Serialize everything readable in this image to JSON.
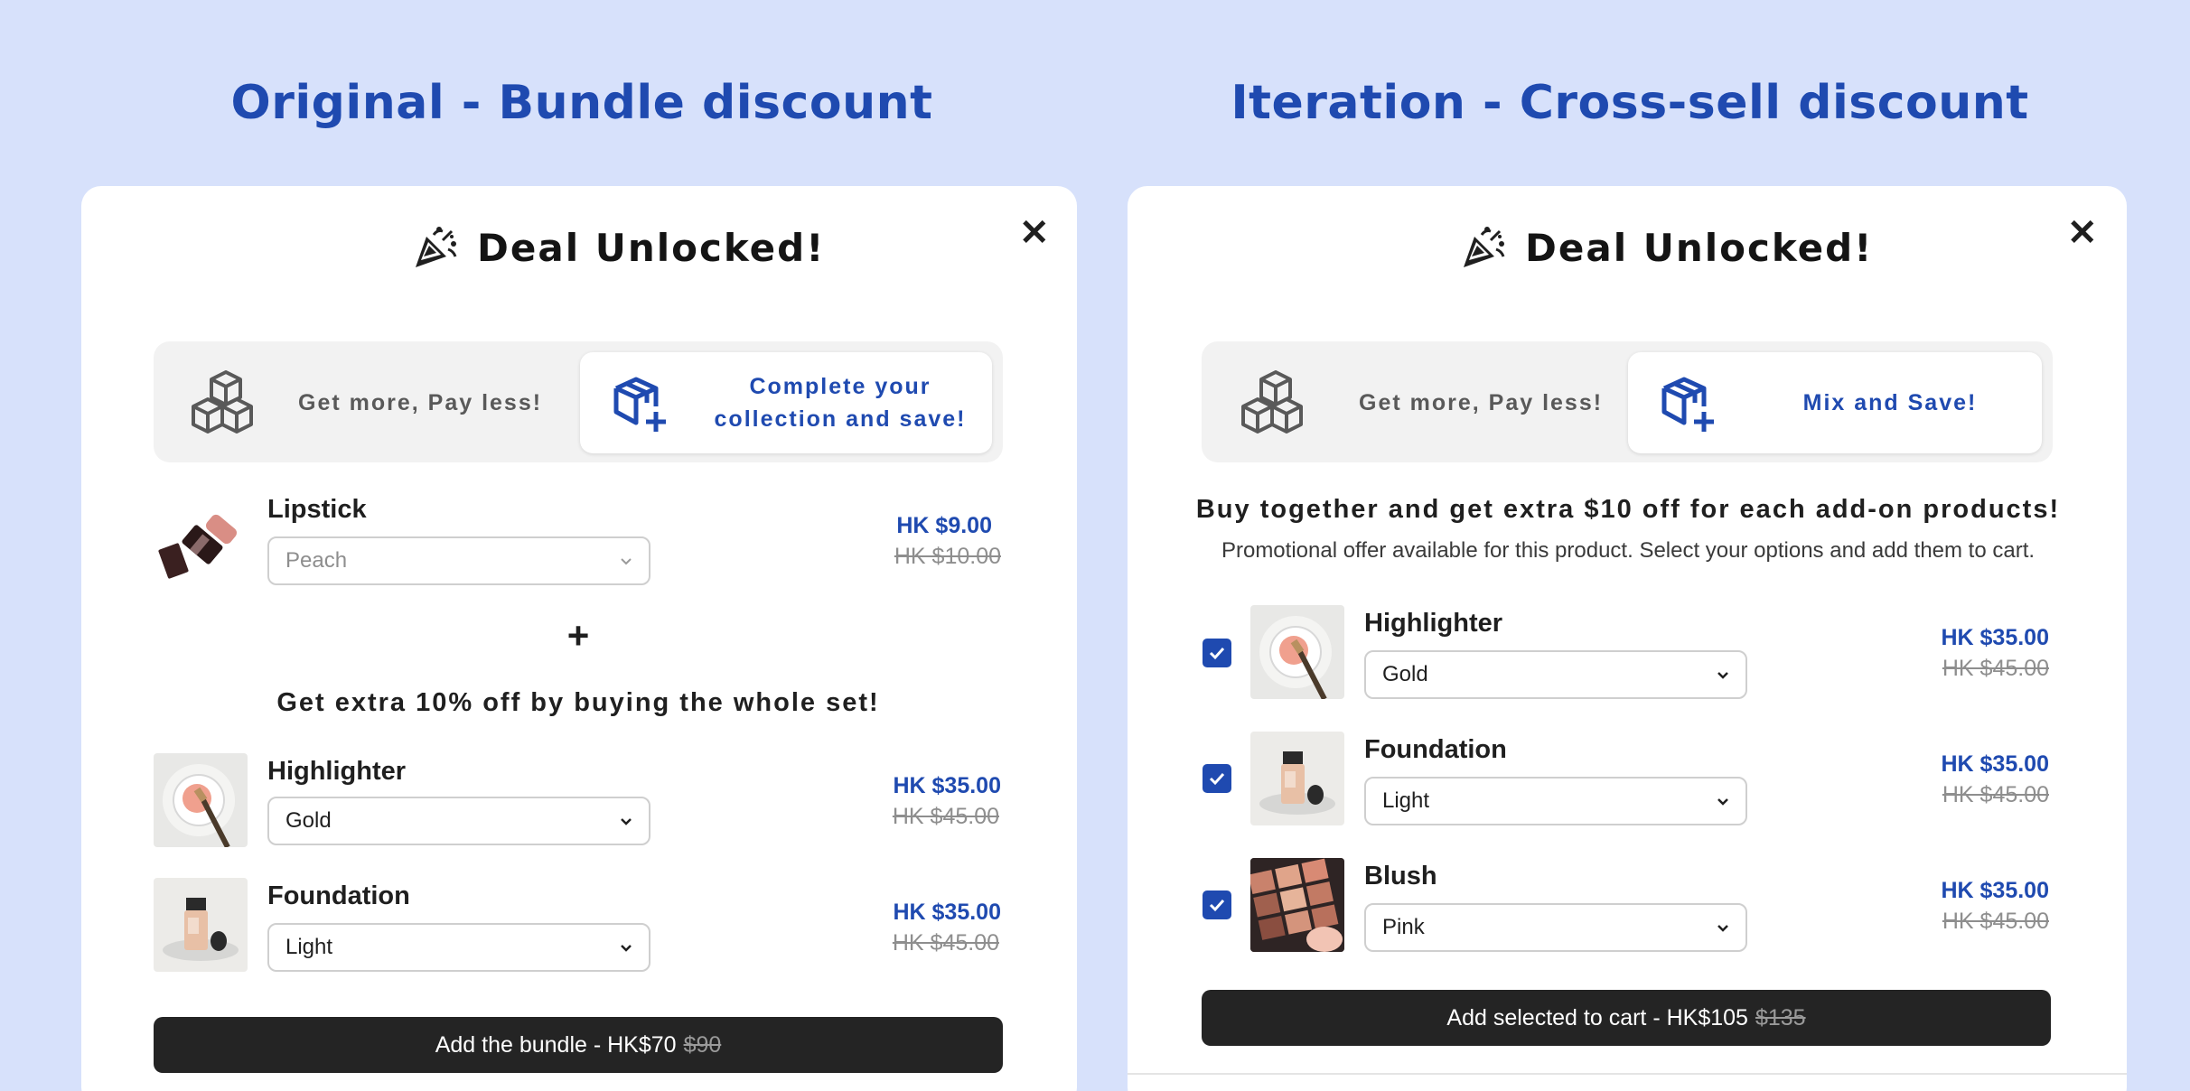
{
  "left": {
    "heading": "Original - Bundle discount",
    "title": "Deal Unlocked!",
    "tabs": [
      {
        "label": "Get more, Pay less!"
      },
      {
        "label_line1": "Complete your",
        "label_line2": "collection and save!"
      }
    ],
    "main_product": {
      "name": "Lipstick",
      "option": "Peach",
      "price": "HK $9.00",
      "old_price": "HK $10.00"
    },
    "plus": "+",
    "promo": "Get extra 10% off by buying the whole set!",
    "products": [
      {
        "name": "Highlighter",
        "option": "Gold",
        "price": "HK $35.00",
        "old_price": "HK $45.00"
      },
      {
        "name": "Foundation",
        "option": "Light",
        "price": "HK $35.00",
        "old_price": "HK $45.00"
      }
    ],
    "cta": {
      "label": "Add the bundle - HK$70",
      "old": "$90"
    }
  },
  "right": {
    "heading": "Iteration - Cross-sell discount",
    "title": "Deal Unlocked!",
    "tabs": [
      {
        "label": "Get more, Pay less!"
      },
      {
        "label": "Mix and Save!"
      }
    ],
    "promo_title": "Buy together and get extra $10 off for each add-on products!",
    "promo_sub": "Promotional offer available for this product. Select your options and add them to cart.",
    "products": [
      {
        "name": "Highlighter",
        "option": "Gold",
        "price": "HK $35.00",
        "old_price": "HK $45.00",
        "checked": true
      },
      {
        "name": "Foundation",
        "option": "Light",
        "price": "HK $35.00",
        "old_price": "HK $45.00",
        "checked": true
      },
      {
        "name": "Blush",
        "option": "Pink",
        "price": "HK $35.00",
        "old_price": "HK $45.00",
        "checked": true
      }
    ],
    "cta": {
      "label": "Add selected to cart - HK$105",
      "old": "$135"
    }
  },
  "close_symbol": "✕",
  "colors": {
    "background": "#d7e1fb",
    "accent": "#1f4ab0",
    "cta": "#242424"
  }
}
